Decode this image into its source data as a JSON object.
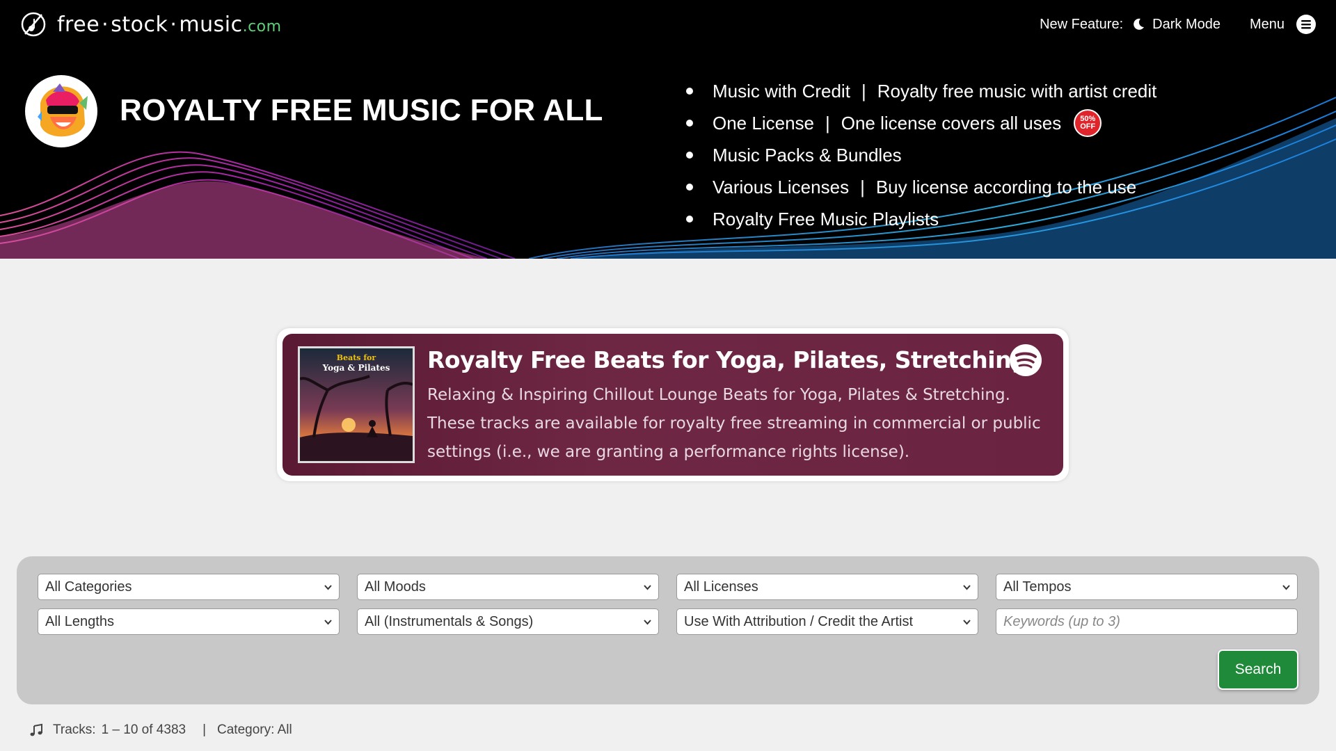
{
  "header": {
    "logo": {
      "word1": "free",
      "word2": "stock",
      "word3": "music",
      "tld": ".com"
    },
    "new_feature_label": "New Feature:",
    "dark_mode_label": "Dark Mode",
    "menu_label": "Menu",
    "icons": [
      "logo-mark-icon",
      "moon-icon",
      "menu-icon"
    ]
  },
  "hero": {
    "title": "ROYALTY FREE MUSIC FOR ALL",
    "features": [
      {
        "label": "Music with Credit",
        "desc": "Royalty free music with artist credit"
      },
      {
        "label": "One License",
        "desc": "One license covers all uses",
        "badge_top": "50%",
        "badge_bottom": "OFF"
      },
      {
        "label": "Music Packs & Bundles"
      },
      {
        "label": "Various Licenses",
        "desc": "Buy license according to the use"
      },
      {
        "label": "Royalty Free Music Playlists"
      }
    ],
    "separator": "|"
  },
  "promo": {
    "cover_small": "Beats for",
    "cover_big": "Yoga & Pilates",
    "title": "Royalty Free Beats for Yoga, Pilates, Stretching",
    "description": "Relaxing & Inspiring Chillout Lounge Beats for Yoga, Pilates & Stretching. These tracks are available for royalty free streaming in commercial or public settings (i.e., we are granting a performance rights license).",
    "icon": "spotify-icon",
    "colors": {
      "background": "#6a2442"
    }
  },
  "filters": {
    "categories": "All Categories",
    "moods": "All Moods",
    "licenses": "All Licenses",
    "tempos": "All Tempos",
    "lengths": "All Lengths",
    "type": "All (Instrumentals & Songs)",
    "usage": "Use With Attribution / Credit the Artist",
    "keywords_placeholder": "Keywords (up to 3)",
    "search_label": "Search",
    "colors": {
      "search_button": "#1e8a3a",
      "panel": "#c8c8c8"
    }
  },
  "status": {
    "tracks_label": "Tracks:",
    "range": "1 – 10 of 4383",
    "separator": "|",
    "category": "Category: All",
    "icon": "music-note-icon"
  }
}
